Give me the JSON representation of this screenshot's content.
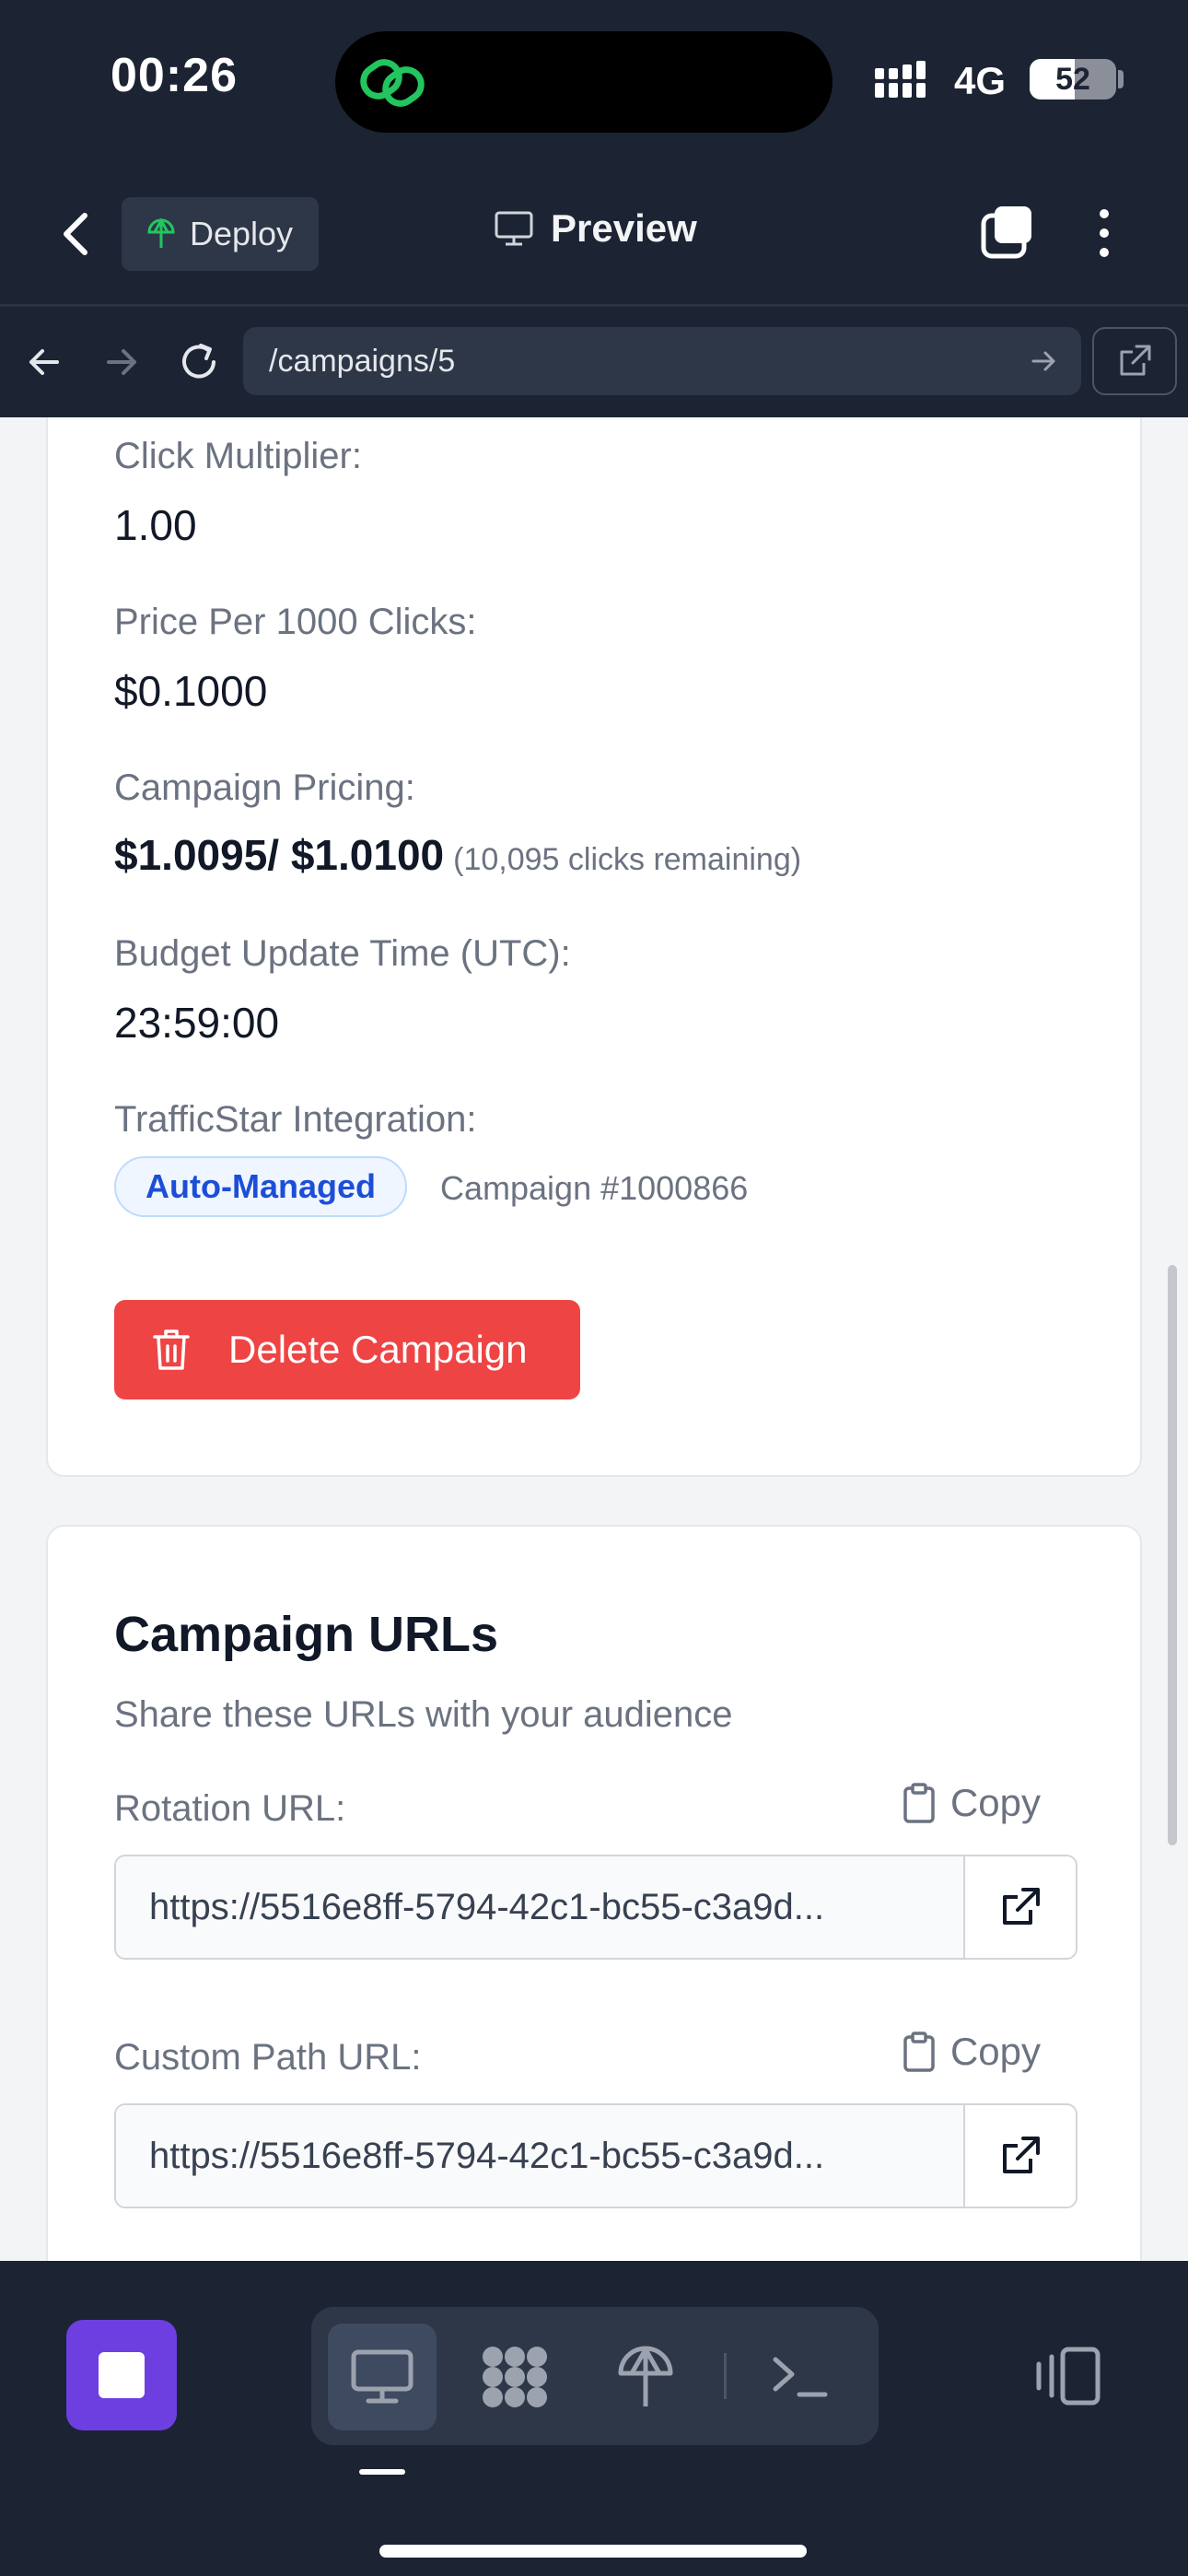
{
  "status_bar": {
    "time": "00:26",
    "network": "4G",
    "battery": "52",
    "battery_level": 0.52
  },
  "header": {
    "deploy_label": "Deploy",
    "preview_label": "Preview"
  },
  "browser": {
    "url": "/campaigns/5"
  },
  "details": {
    "click_multiplier_label": "Click Multiplier:",
    "click_multiplier_value": "1.00",
    "price_label": "Price Per 1000 Clicks:",
    "price_value": "$0.1000",
    "pricing_label": "Campaign Pricing:",
    "pricing_value": "$1.0095/ $1.0100",
    "pricing_note": "(10,095 clicks remaining)",
    "budget_label": "Budget Update Time (UTC):",
    "budget_value": "23:59:00",
    "integration_label": "TrafficStar Integration:",
    "integration_badge": "Auto-Managed",
    "integration_campaign": "Campaign #1000866",
    "delete_label": "Delete Campaign"
  },
  "urls": {
    "title": "Campaign URLs",
    "subtitle": "Share these URLs with your audience",
    "rotation_label": "Rotation URL:",
    "rotation_value": "https://5516e8ff-5794-42c1-bc55-c3a9d...",
    "custom_label": "Custom Path URL:",
    "custom_value": "https://5516e8ff-5794-42c1-bc55-c3a9d...",
    "copy_label": "Copy"
  },
  "colors": {
    "accent": "#6d3fe0",
    "danger": "#ef4444",
    "badge": "#1d4ed8",
    "dark_bg": "#1c2333"
  },
  "icons": [
    "back-icon",
    "deploy-icon",
    "monitor-icon",
    "tabs-icon",
    "more-icon",
    "arrow-left-icon",
    "arrow-right-icon",
    "reload-icon",
    "external-link-icon",
    "trash-icon",
    "clipboard-icon",
    "stop-icon",
    "webview-icon",
    "apps-icon",
    "deploy-icon",
    "terminal-icon",
    "layout-icon"
  ]
}
